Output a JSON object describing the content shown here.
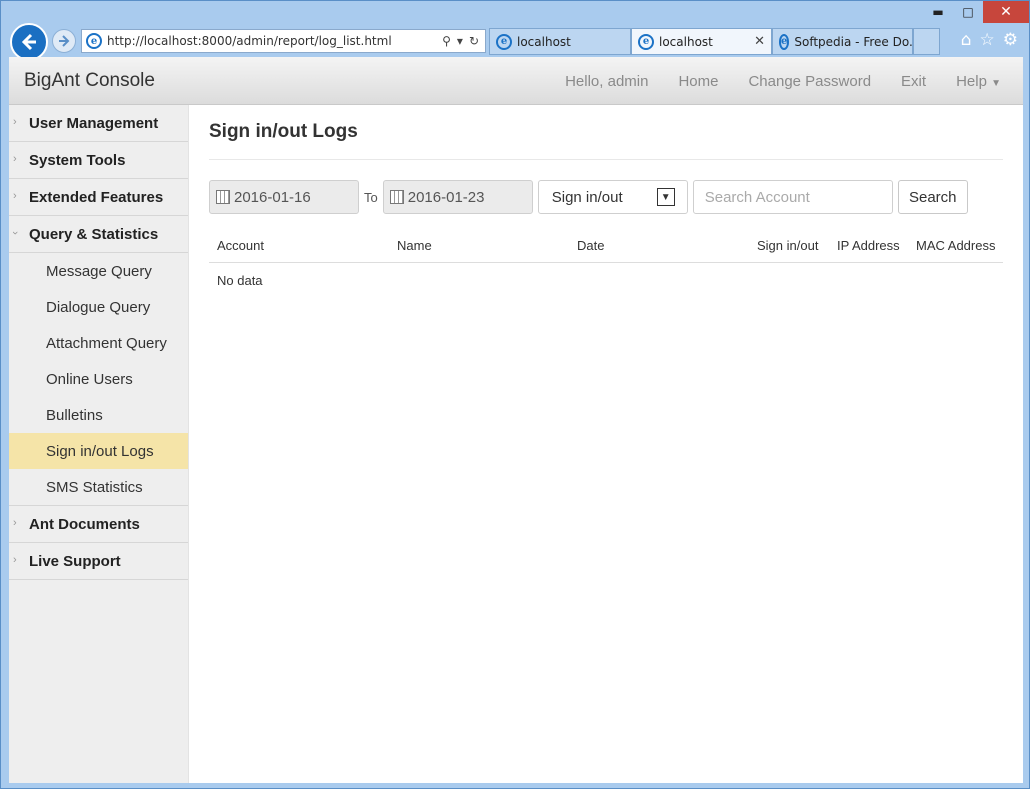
{
  "browser": {
    "url": "http://localhost:8000/admin/report/log_list.html",
    "tabs": [
      {
        "label": "localhost",
        "active": false
      },
      {
        "label": "localhost",
        "active": true
      },
      {
        "label": "Softpedia - Free Do...",
        "active": false
      }
    ]
  },
  "app": {
    "brand": "BigAnt Console",
    "nav": {
      "greeting": "Hello, admin",
      "home": "Home",
      "change_password": "Change Password",
      "exit": "Exit",
      "help": "Help"
    }
  },
  "sidebar": {
    "sections": [
      {
        "label": "User Management"
      },
      {
        "label": "System Tools"
      },
      {
        "label": "Extended Features"
      },
      {
        "label": "Query & Statistics"
      },
      {
        "label": "Ant Documents"
      },
      {
        "label": "Live Support"
      }
    ],
    "query_items": [
      {
        "label": "Message Query"
      },
      {
        "label": "Dialogue Query"
      },
      {
        "label": "Attachment Query"
      },
      {
        "label": "Online Users"
      },
      {
        "label": "Bulletins"
      },
      {
        "label": "Sign in/out Logs"
      },
      {
        "label": "SMS Statistics"
      }
    ]
  },
  "main": {
    "title": "Sign in/out Logs",
    "filters": {
      "date_from": "2016-01-16",
      "to_label": "To",
      "date_to": "2016-01-23",
      "type_selected": "Sign in/out",
      "search_placeholder": "Search Account",
      "search_button": "Search"
    },
    "table": {
      "columns": [
        "Account",
        "Name",
        "Date",
        "Sign in/out",
        "IP Address",
        "MAC Address"
      ],
      "empty_text": "No data"
    }
  },
  "colors": {
    "active_item": "#f5e4a8",
    "sidebar_bg": "#eeeeee",
    "browser_back": "#1a6fc2"
  }
}
